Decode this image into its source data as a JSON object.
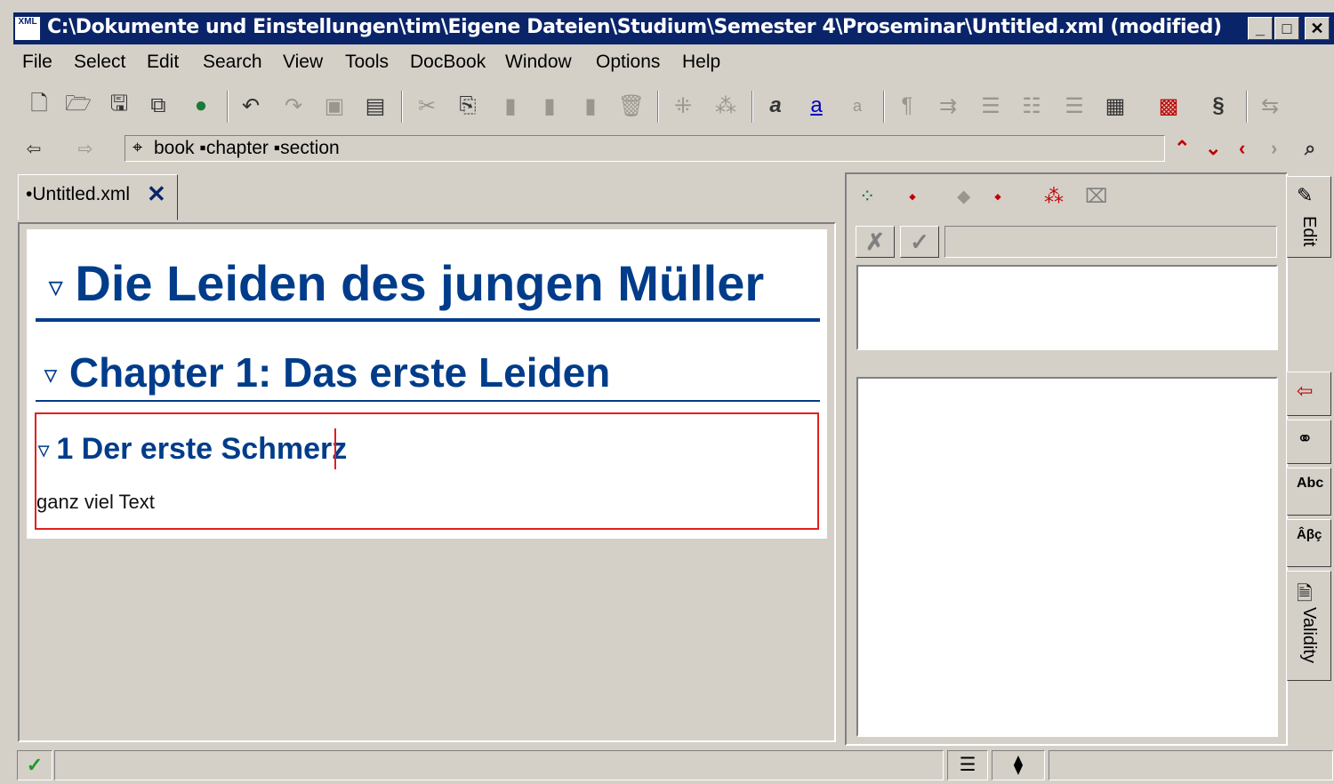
{
  "window": {
    "title": "C:\\Dokumente und Einstellungen\\tim\\Eigene Dateien\\Studium\\Semester 4\\Proseminar\\Untitled.xml (modified)",
    "app_icon_text": "XML",
    "controls": {
      "minimize": "_",
      "maximize": "□",
      "close": "✕"
    }
  },
  "menu": {
    "items": [
      "File",
      "Select",
      "Edit",
      "Search",
      "View",
      "Tools",
      "DocBook",
      "Window",
      "Options",
      "Help"
    ]
  },
  "toolbar": {
    "icons": [
      "new-document-icon",
      "open-folder-icon",
      "save-icon",
      "save-all-icon",
      "globe-icon",
      "undo-icon",
      "redo-icon",
      "repeat-icon",
      "command-history-icon",
      "cut-icon",
      "copy-icon",
      "paste-before-icon",
      "paste-icon",
      "paste-after-icon",
      "delete-icon",
      "split-icon",
      "join-icon",
      "text-style-icon",
      "text-color-icon",
      "text-small-icon",
      "paragraph-icon",
      "indent-icon",
      "bulleted-list-icon",
      "numbered-list-icon",
      "variable-list-icon",
      "table-icon",
      "image-icon",
      "section-icon",
      "navigate-icon"
    ]
  },
  "breadcrumb": {
    "path": "book ▪chapter ▪section"
  },
  "editor": {
    "tab_label": "•Untitled.xml",
    "tab_close": "✕",
    "book_title": "Die Leiden des jungen Müller",
    "chapter_title": "Chapter 1: Das erste Leiden",
    "section_title": "1 Der erste Schmerz",
    "paragraph": "ganz viel Text"
  },
  "side_tabs": {
    "edit": "Edit",
    "validity": "Validity"
  },
  "colors": {
    "title_bar": "#0a246a",
    "heading": "#003c8a",
    "selection_border": "#e02020",
    "chrome": "#d4d0c8"
  }
}
